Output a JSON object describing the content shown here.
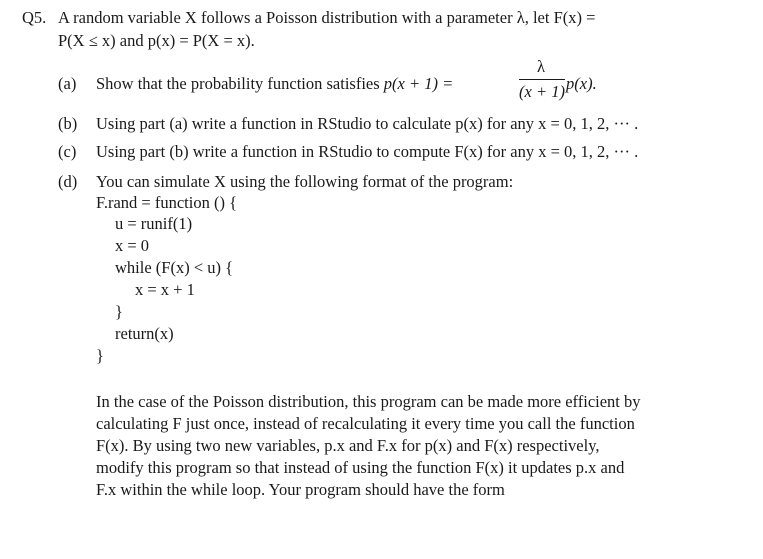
{
  "question": {
    "number": "Q5.",
    "intro_line1": "A random variable X follows a Poisson distribution with a parameter λ, let F(x) =",
    "intro_line2": "P(X ≤ x) and p(x) = P(X = x)."
  },
  "parts": [
    {
      "label": "(a)",
      "text": "Show that the probability function satisfies",
      "lhs": "p(x + 1) =",
      "frac_num": "λ",
      "frac_den": "(x + 1)",
      "rhs": "p(x)."
    },
    {
      "label": "(b)",
      "text": "Using part (a) write a function in RStudio to calculate p(x) for any x = 0, 1, 2, ··· ."
    },
    {
      "label": "(c)",
      "text": "Using part (b) write a function in RStudio to compute F(x) for any x = 0, 1, 2, ··· ."
    },
    {
      "label": "(d)",
      "text": "You can simulate X using the following format of the program:"
    }
  ],
  "code_lines": [
    "F.rand = function () {",
    "u = runif(1)",
    "x = 0",
    "while (F(x) < u) {",
    "x = x + 1",
    "}",
    "return(x)",
    "}"
  ],
  "closing_paragraph": [
    "In the case of the Poisson distribution, this program can be made more efficient by",
    "calculating F just once, instead of recalculating it every time you call the function",
    "F(x). By using two new variables, p.x and F.x for p(x) and F(x) respectively,",
    "modify this program so that instead of using the function F(x) it updates p.x and",
    "F.x within the while loop. Your program should have the form"
  ]
}
